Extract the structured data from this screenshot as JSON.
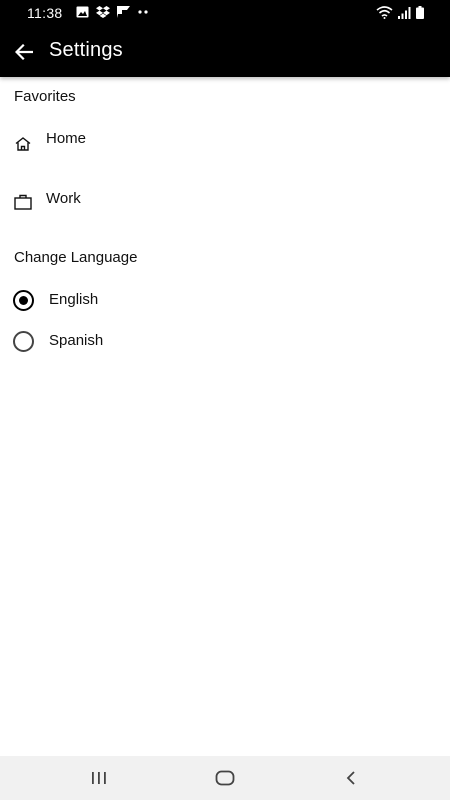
{
  "status_bar": {
    "time": "11:38",
    "icons_left": [
      "gallery-icon",
      "dropbox-icon",
      "flipboard-icon",
      "more-dots-icon"
    ],
    "icons_right": [
      "wifi-icon",
      "signal-icon",
      "battery-icon"
    ]
  },
  "app_bar": {
    "title": "Settings",
    "back_icon": "arrow-back-icon"
  },
  "favorites": {
    "section_title": "Favorites",
    "items": [
      {
        "label": "Home",
        "icon": "home-icon"
      },
      {
        "label": "Work",
        "icon": "briefcase-icon"
      }
    ]
  },
  "language": {
    "section_title": "Change Language",
    "options": [
      {
        "label": "English",
        "selected": true
      },
      {
        "label": "Spanish",
        "selected": false
      }
    ]
  },
  "nav_bar": {
    "buttons": [
      "recent-apps-icon",
      "home-circle-icon",
      "back-chevron-icon"
    ]
  },
  "colors": {
    "app_bar_bg": "#000000",
    "nav_bar_bg": "#f1f1f1",
    "text": "#111111"
  }
}
